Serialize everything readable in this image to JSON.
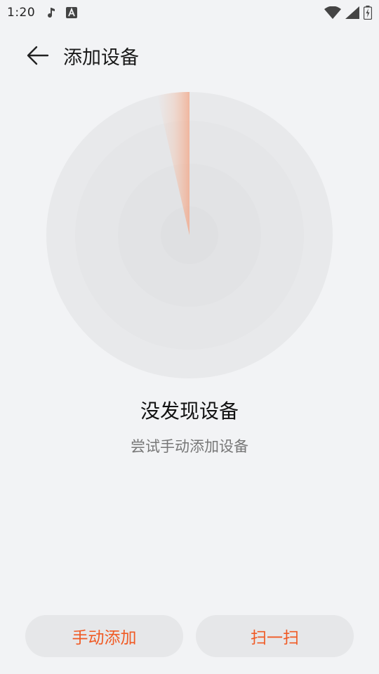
{
  "status_bar": {
    "time": "1:20",
    "notification_icons": [
      "music-note-icon",
      "font-a-icon"
    ],
    "system_icons": [
      "wifi-icon",
      "signal-icon",
      "battery-charging-icon"
    ]
  },
  "header": {
    "back_icon": "arrow-left-icon",
    "title": "添加设备"
  },
  "radar": {
    "accent": "#F39A7A"
  },
  "empty_state": {
    "title": "没发现设备",
    "subtitle": "尝试手动添加设备"
  },
  "actions": {
    "manual_add_label": "手动添加",
    "scan_label": "扫一扫",
    "label_color": "#F05A24"
  }
}
